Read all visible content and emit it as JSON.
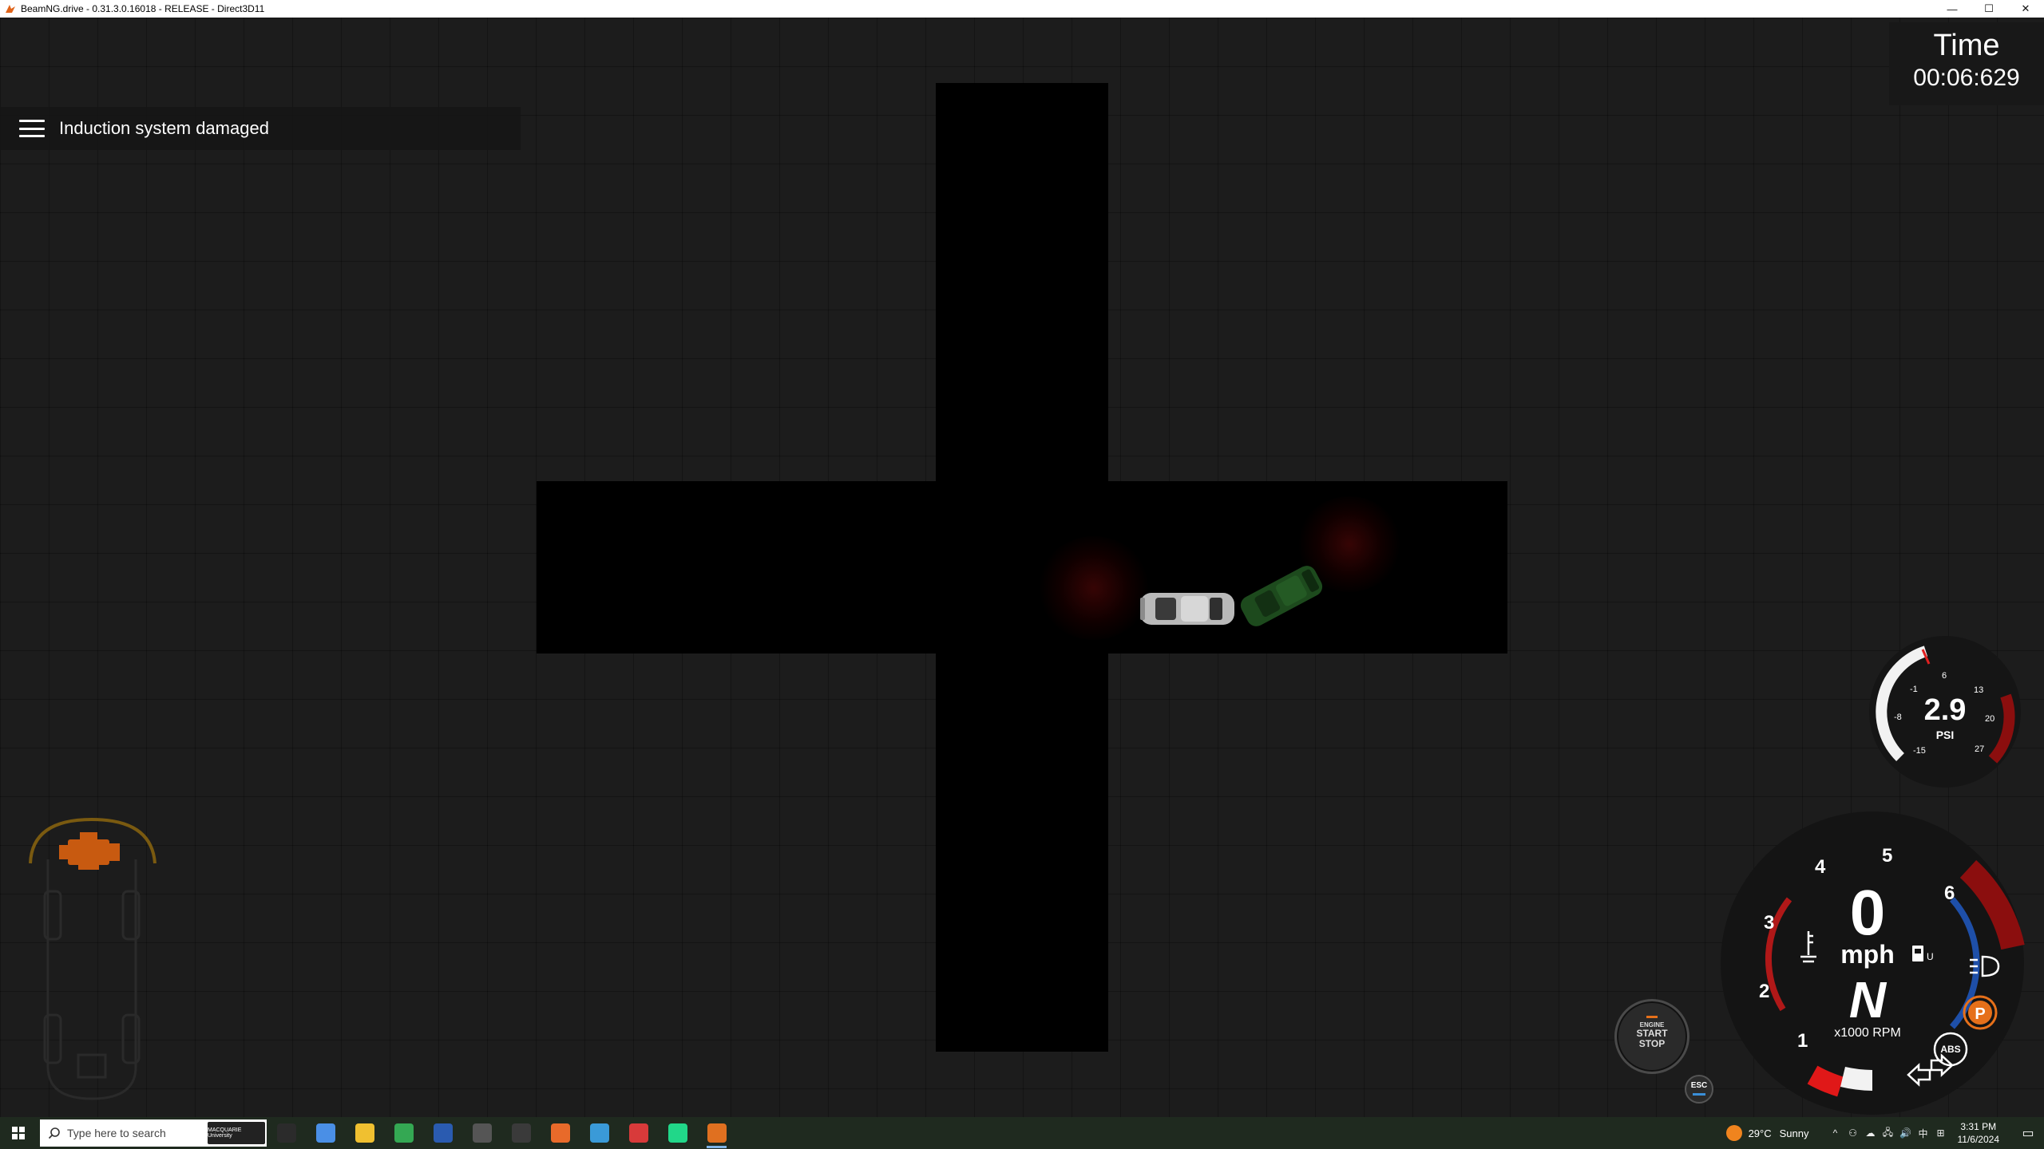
{
  "window": {
    "title": "BeamNG.drive - 0.31.3.0.16018 - RELEASE - Direct3D11",
    "minimize_icon": "—",
    "maximize_icon": "☐",
    "close_icon": "✕"
  },
  "hud": {
    "message": "Induction system damaged",
    "timer": {
      "label": "Time",
      "value": "00:06:629"
    },
    "boost_gauge": {
      "value": "2.9",
      "unit": "PSI",
      "ticks": [
        "-15",
        "-8",
        "-1",
        "6",
        "13",
        "20",
        "27"
      ],
      "level": 0.42,
      "accent": "#a31010"
    },
    "main_gauge": {
      "speed": "0",
      "speed_unit": "mph",
      "gear": "N",
      "rpm_label": "x1000 RPM",
      "rpm_ticks": [
        "1",
        "2",
        "3",
        "4",
        "5",
        "6"
      ],
      "fuel_label": "U",
      "colors": {
        "redline": "#8b0e0e",
        "fuel": "#1e4fa8",
        "temp": "#b01818",
        "parking": "#e6701a"
      }
    },
    "parking_brake": "P",
    "abs": "ABS",
    "engine_button": {
      "line1": "ENGINE",
      "line2": "START",
      "line3": "STOP"
    },
    "esc": "ESC",
    "damage_color": "#c87a10"
  },
  "taskbar": {
    "search_placeholder": "Type here to search",
    "search_badge": "MACQUARIE University",
    "apps": [
      {
        "name": "task-view",
        "color": "#2b2b2b"
      },
      {
        "name": "copilot",
        "color": "#4a8fe6"
      },
      {
        "name": "file-explorer",
        "color": "#f0c030"
      },
      {
        "name": "chrome",
        "color": "#34a853"
      },
      {
        "name": "powershell",
        "color": "#2a5bb0"
      },
      {
        "name": "window-app",
        "color": "#555555"
      },
      {
        "name": "terminal",
        "color": "#3a3a3a"
      },
      {
        "name": "notes-app",
        "color": "#e86a2a"
      },
      {
        "name": "browser-app",
        "color": "#3a9ad8"
      },
      {
        "name": "red-app",
        "color": "#d83a3a"
      },
      {
        "name": "pycharm",
        "color": "#21d789"
      },
      {
        "name": "beamng",
        "color": "#e07020"
      }
    ],
    "weather": {
      "temp": "29°C",
      "condition": "Sunny"
    },
    "tray_icons": [
      "^",
      "⚇",
      "☁",
      "🖧",
      "🔊",
      "中",
      "⊞"
    ],
    "clock": {
      "time": "3:31 PM",
      "date": "11/6/2024"
    }
  }
}
